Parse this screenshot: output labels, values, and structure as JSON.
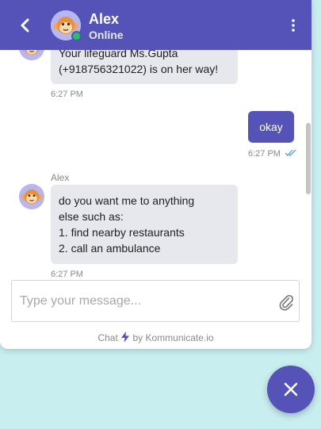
{
  "header": {
    "name": "Alex",
    "status": "Online"
  },
  "messages": [
    {
      "from": "agent",
      "lines": [
        "Your lifeguard Ms.Gupta",
        "(+918756321022) is on her way!"
      ],
      "time": "6:27 PM"
    },
    {
      "from": "user",
      "text": "okay",
      "time": "6:27 PM"
    },
    {
      "from": "agent",
      "sender": "Alex",
      "lines": [
        "do you want me to anything",
        "else such as:",
        "1. find nearby restaurants",
        "2. call an ambulance"
      ],
      "time": "6:27 PM"
    }
  ],
  "composer": {
    "placeholder": "Type your message..."
  },
  "footer": {
    "prefix": "Chat",
    "suffix": "by Kommunicate.io"
  },
  "colors": {
    "brand": "#5553b7",
    "bubble_in": "#e7e7ee",
    "online": "#22c55e",
    "read_ticks": "#4fa3e0"
  },
  "icons": {
    "back": "chevron-left-icon",
    "menu": "kebab-menu-icon",
    "attach": "paperclip-icon",
    "read": "double-check-icon",
    "bolt": "lightning-icon",
    "close": "close-icon"
  }
}
